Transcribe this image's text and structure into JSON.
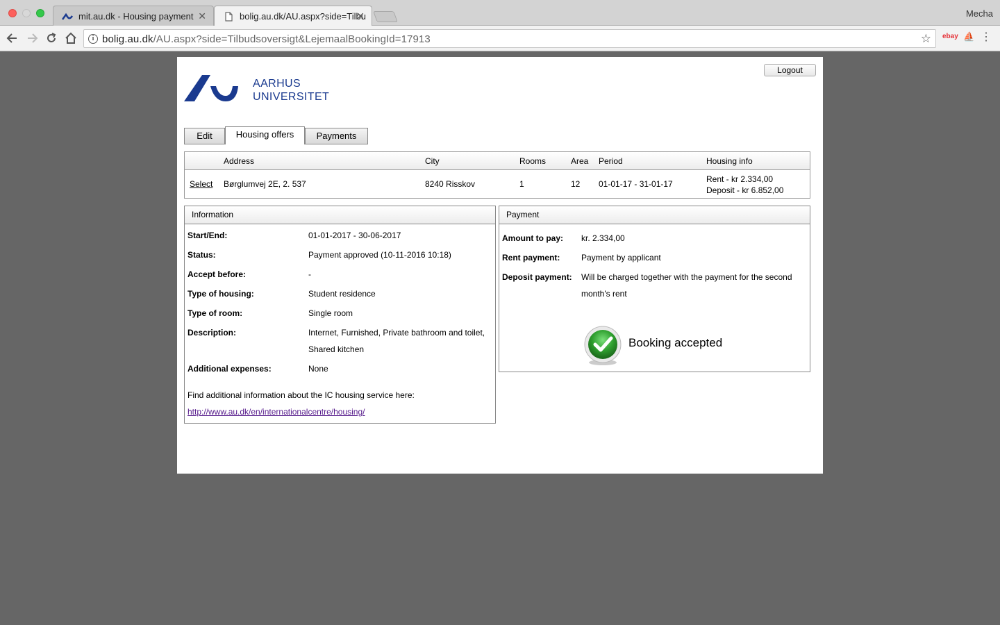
{
  "browser": {
    "tabs": [
      {
        "title": "mit.au.dk - Housing payment"
      },
      {
        "title": "bolig.au.dk/AU.aspx?side=Tilbu"
      }
    ],
    "profile": "Mecha",
    "url_host": "bolig.au.dk",
    "url_path": "/AU.aspx?side=Tilbudsoversigt&LejemaalBookingId=17913"
  },
  "page": {
    "logout_label": "Logout",
    "logo": {
      "line1": "AARHUS",
      "line2": "UNIVERSITET",
      "color": "#1a3a8f"
    },
    "tabs": [
      "Edit",
      "Housing offers",
      "Payments"
    ],
    "offers": {
      "headers": [
        "Address",
        "City",
        "Rooms",
        "Area",
        "Period",
        "Housing info"
      ],
      "row": {
        "select": "Select",
        "address": "Børglumvej 2E, 2. 537",
        "city": "8240 Risskov",
        "rooms": "1",
        "area": "12",
        "period": "01-01-17 - 31-01-17",
        "rent": "Rent - kr 2.334,00",
        "deposit": "Deposit - kr 6.852,00"
      }
    },
    "information": {
      "title": "Information",
      "rows": [
        {
          "label": "Start/End:",
          "value": "01-01-2017 - 30-06-2017"
        },
        {
          "label": "Status:",
          "value": "Payment approved (10-11-2016 10:18)"
        },
        {
          "label": "Accept before:",
          "value": "-"
        },
        {
          "label": "Type of housing:",
          "value": "Student residence"
        },
        {
          "label": "Type of room:",
          "value": "Single room"
        },
        {
          "label": "Description:",
          "value": "Internet, Furnished, Private bathroom and toilet,",
          "value2": "Shared kitchen"
        },
        {
          "label": "Additional expenses:",
          "value": "None"
        }
      ],
      "footer_text": "Find additional information about the IC housing service here:",
      "link": "http://www.au.dk/en/internationalcentre/housing/"
    },
    "payment": {
      "title": "Payment",
      "rows": [
        {
          "label": "Amount to pay:",
          "value": "kr. 2.334,00"
        },
        {
          "label": "Rent payment:",
          "value": "Payment by applicant"
        },
        {
          "label": "Deposit payment:",
          "value": "Will be charged together with the payment for the second",
          "value2": "month's rent"
        }
      ],
      "status": "Booking accepted",
      "status_color": "#2e9e2e"
    }
  }
}
